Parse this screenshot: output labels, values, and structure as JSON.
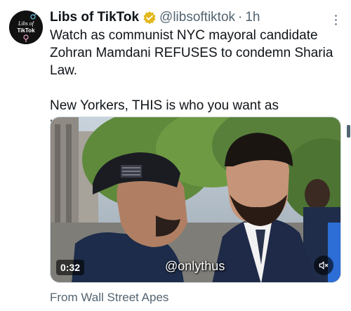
{
  "tweet": {
    "display_name": "Libs of TikTok",
    "handle": "@libsoftiktok",
    "separator": "·",
    "time": "1h",
    "text_lines": [
      "Watch as communist NYC mayoral candidate Zohran Mamdani REFUSES to condemn Sharia Law.",
      "New Yorkers, THIS is who you want as mayor???"
    ],
    "avatar_text": [
      "Libs of",
      "TikTok"
    ],
    "verified_color": "#e2b719"
  },
  "video": {
    "duration": "0:32",
    "watermark": "@onlythus",
    "mute_icon": "volume-muted-icon"
  },
  "source": {
    "label": "From Wall Street Apes"
  }
}
